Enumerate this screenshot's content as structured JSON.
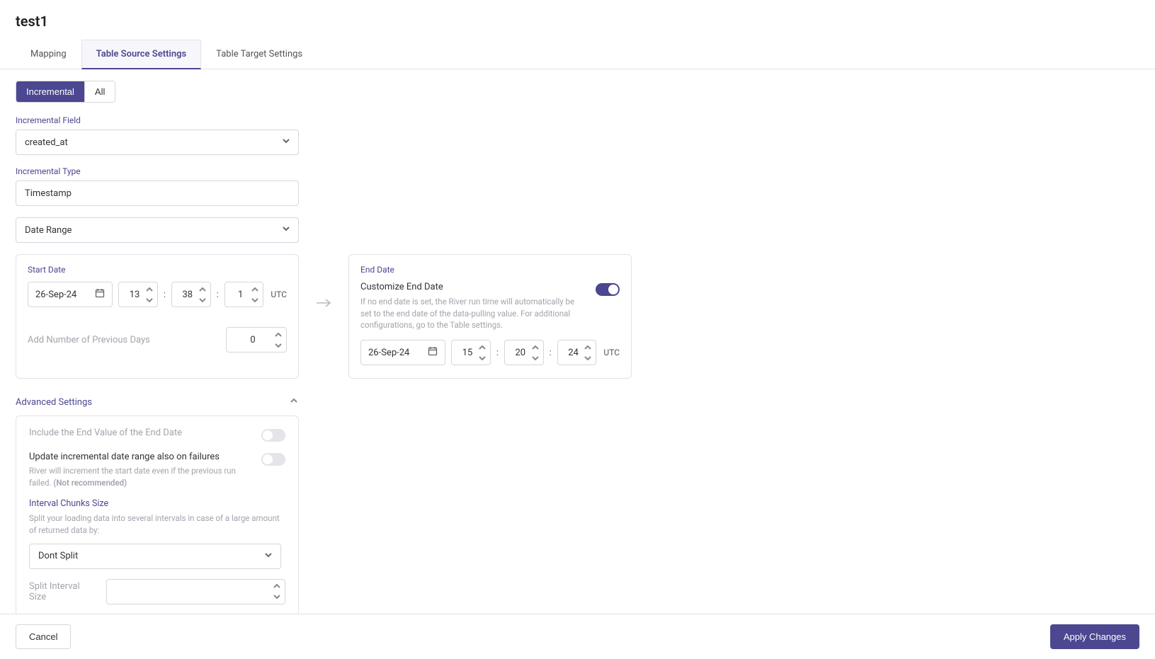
{
  "pageTitle": "test1",
  "tabs": {
    "mapping": "Mapping",
    "tableSource": "Table Source Settings",
    "tableTarget": "Table Target Settings"
  },
  "segToggle": {
    "incremental": "Incremental",
    "all": "All"
  },
  "incrementalField": {
    "label": "Incremental Field",
    "value": "created_at"
  },
  "incrementalType": {
    "label": "Incremental Type",
    "value": "Timestamp"
  },
  "dateRange": {
    "value": "Date Range"
  },
  "startDate": {
    "title": "Start Date",
    "date": "26-Sep-24",
    "hour": "13",
    "minute": "38",
    "second": "1",
    "tz": "UTC",
    "prevDaysLabel": "Add Number of Previous Days",
    "prevDaysValue": "0"
  },
  "endDate": {
    "title": "End Date",
    "customizeLabel": "Customize End Date",
    "desc": "If no end date is set, the River run time will automatically be set to the end date of the data-pulling value. For additional configurations, go to the Table settings.",
    "date": "26-Sep-24",
    "hour": "15",
    "minute": "20",
    "second": "24",
    "tz": "UTC"
  },
  "advanced": {
    "title": "Advanced Settings",
    "includeEndValueLabel": "Include the End Value of the End Date",
    "updateOnFailLabel": "Update incremental date range also on failures",
    "updateOnFailDesc": "River will increment the start date even if the previous run failed.",
    "updateOnFailDescBold": "(Not recommended)",
    "intervalTitle": "Interval Chunks Size",
    "intervalDesc": "Split your loading data into several intervals in case of a large amount of returned data by:",
    "intervalValue": "Dont Split",
    "splitLabel": "Split Interval Size",
    "splitValue": ""
  },
  "footer": {
    "cancel": "Cancel",
    "apply": "Apply Changes"
  }
}
